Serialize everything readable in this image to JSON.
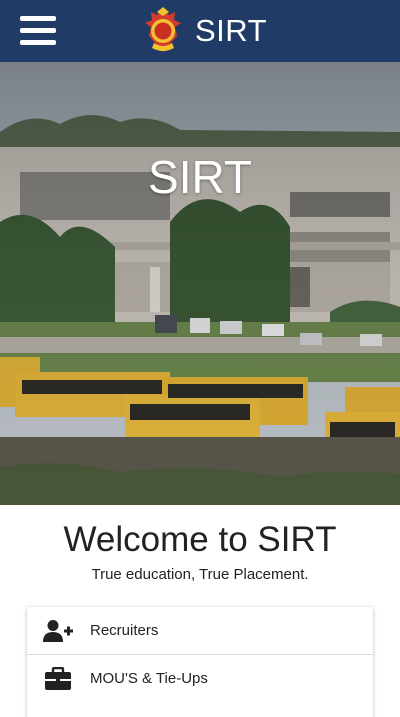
{
  "app_bar": {
    "title": "SIRT",
    "menu_icon": "hamburger-menu-icon",
    "logo": "sirt-crest-logo",
    "background": "#1f3b66"
  },
  "hero": {
    "title": "SIRT",
    "image": "campus-photo-with-school-buses"
  },
  "welcome": {
    "heading": "Welcome to SIRT",
    "tagline": "True education, True Placement."
  },
  "menu": {
    "items": [
      {
        "label": "Recruiters",
        "icon": "user-plus-icon"
      },
      {
        "label": "MOU'S & Tie-Ups",
        "icon": "briefcase-icon"
      }
    ]
  }
}
